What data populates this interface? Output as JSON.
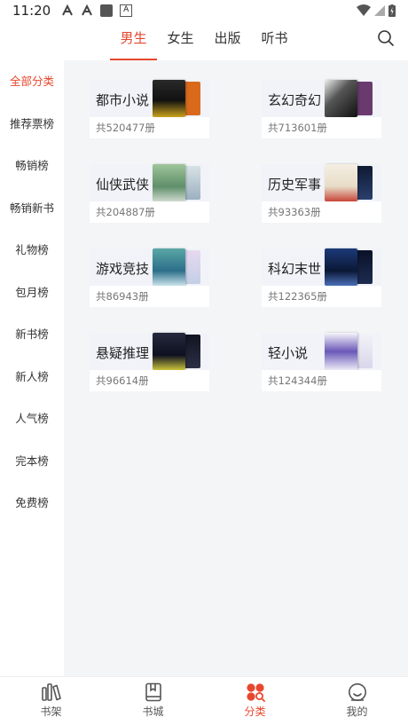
{
  "status_bar": {
    "time": "11:20",
    "box_icon_text": "A"
  },
  "tabs": [
    {
      "label": "男生",
      "active": true
    },
    {
      "label": "女生",
      "active": false
    },
    {
      "label": "出版",
      "active": false
    },
    {
      "label": "听书",
      "active": false
    }
  ],
  "sidebar": {
    "items": [
      {
        "label": "全部分类",
        "active": true
      },
      {
        "label": "推荐票榜"
      },
      {
        "label": "畅销榜"
      },
      {
        "label": "畅销新书"
      },
      {
        "label": "礼物榜"
      },
      {
        "label": "包月榜"
      },
      {
        "label": "新书榜"
      },
      {
        "label": "新人榜"
      },
      {
        "label": "人气榜"
      },
      {
        "label": "完本榜"
      },
      {
        "label": "免费榜"
      }
    ]
  },
  "categories": [
    {
      "name": "都市小说",
      "count": "共520477册",
      "cover_colors": [
        "#1a1a1a",
        "#d96a1c"
      ]
    },
    {
      "name": "玄幻奇幻",
      "count": "共713601册",
      "cover_colors": [
        "#2b2b2b",
        "#6a3a6e"
      ]
    },
    {
      "name": "仙侠武侠",
      "count": "共204887册",
      "cover_colors": [
        "#7aa37a",
        "#cbd7d8"
      ]
    },
    {
      "name": "历史军事",
      "count": "共93363册",
      "cover_colors": [
        "#f1ede2",
        "#1b2b4a"
      ]
    },
    {
      "name": "游戏竞技",
      "count": "共86943册",
      "cover_colors": [
        "#5ea6a8",
        "#c7d6e6"
      ]
    },
    {
      "name": "科幻末世",
      "count": "共122365册",
      "cover_colors": [
        "#16305a",
        "#0e1a35"
      ]
    },
    {
      "name": "悬疑推理",
      "count": "共96614册",
      "cover_colors": [
        "#1e2030",
        "#0d0f1a"
      ]
    },
    {
      "name": "轻小说",
      "count": "共124344册",
      "cover_colors": [
        "#4a3a8a",
        "#efeef6"
      ]
    }
  ],
  "bottom_nav": [
    {
      "label": "书架",
      "icon": "bookshelf-icon",
      "active": false
    },
    {
      "label": "书城",
      "icon": "bookstore-icon",
      "active": false
    },
    {
      "label": "分类",
      "icon": "category-icon",
      "active": true
    },
    {
      "label": "我的",
      "icon": "profile-icon",
      "active": false
    }
  ],
  "colors": {
    "accent": "#e7472e",
    "background": "#f4f5f7"
  }
}
